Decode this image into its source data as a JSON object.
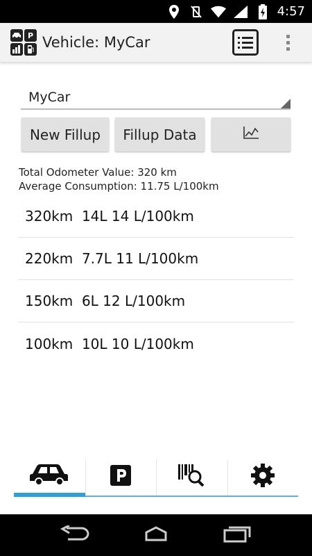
{
  "status_bar": {
    "time": "4:57"
  },
  "action_bar": {
    "title": "Vehicle: MyCar",
    "logo_letters": [
      "P"
    ]
  },
  "vehicle_selector": {
    "value": "MyCar"
  },
  "buttons": {
    "new_fillup": "New Fillup",
    "fillup_data": "Fillup Data",
    "chart_icon": "line-chart-icon"
  },
  "summary": {
    "total_odometer": "Total Odometer Value: 320 km",
    "average_consumption": "Average Consumption: 11.75 L/100km"
  },
  "fillups": [
    {
      "text": "320km  14L 14 L/100km"
    },
    {
      "text": "220km  7.7L 11 L/100km"
    },
    {
      "text": "150km  6L 12 L/100km"
    },
    {
      "text": "100km  10L 10 L/100km"
    }
  ],
  "tabs": [
    {
      "icon": "car-icon",
      "active": true
    },
    {
      "icon": "parking-icon",
      "active": false
    },
    {
      "icon": "barcode-search-icon",
      "active": false
    },
    {
      "icon": "gear-icon",
      "active": false
    }
  ],
  "colors": {
    "accent": "#31a0d8",
    "action_bar_bg": "#f2f2f2",
    "button_bg": "#e1e1e1"
  }
}
